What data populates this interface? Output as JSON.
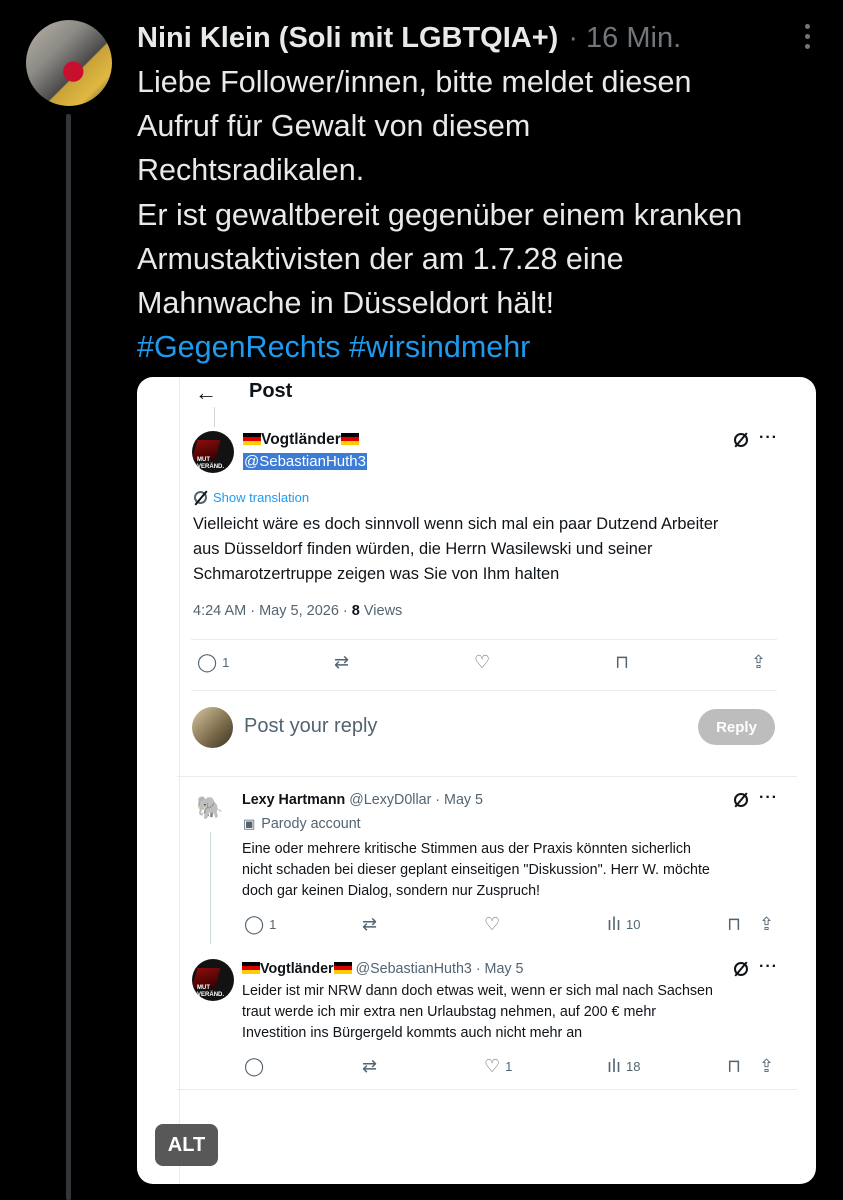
{
  "post": {
    "author_name": "Nini Klein (Soli mit LGBTQIA+)",
    "time": "· 16 Min.",
    "body_lines": [
      "Liebe Follower/innen, bitte meldet diesen",
      "Aufruf für Gewalt von diesem",
      "Rechtsradikalen.",
      "Er ist gewaltbereit gegenüber einem kranken",
      "Armustaktivisten der am 1.7.28 eine",
      "Mahnwache in Düsseldort hält!"
    ],
    "hashtags": [
      "#GegenRechts",
      "#wirsindmehr"
    ],
    "alt_label": "ALT"
  },
  "screenshot": {
    "header_title": "Post",
    "main_tweet": {
      "user_name": "Vogtländer",
      "handle": "@SebastianHuth3",
      "show_translation": "Show translation",
      "text_lines": [
        "Vielleicht wäre es doch sinnvoll wenn sich mal ein paar Dutzend Arbeiter",
        "aus Düsseldorf finden würden, die Herrn Wasilewski und seiner",
        "Schmarotzertruppe zeigen was Sie von Ihm halten"
      ],
      "timestamp": "4:24 AM · May 5, 2026 · ",
      "views_count": "8",
      "views_label": " Views",
      "reply_count": "1"
    },
    "reply_box": {
      "placeholder": "Post your reply",
      "button": "Reply"
    },
    "replies": [
      {
        "user_name": "Lexy Hartmann",
        "meta": "@LexyD0llar · May 5",
        "badge": "Parody account",
        "text_lines": [
          "Eine oder mehrere kritische Stimmen aus der Praxis könnten sicherlich",
          "nicht schaden bei dieser geplant einseitigen \"Diskussion\". Herr W. möchte",
          "doch gar keinen Dialog, sondern nur Zuspruch!"
        ],
        "reply_count": "1",
        "views": "10"
      },
      {
        "user_name": "Vogtländer",
        "meta": "@SebastianHuth3 · May 5",
        "text_lines": [
          "Leider ist mir NRW dann doch etwas weit, wenn er sich mal nach Sachsen",
          "traut werde ich mir extra nen Urlaubstag nehmen, auf 200 € mehr",
          "Investition ins Bürgergeld kommts auch nicht mehr an"
        ],
        "like_count": "1",
        "views": "18"
      }
    ]
  },
  "colors": {
    "link": "#1d9bf0",
    "background": "#000000",
    "muted": "#71767b"
  },
  "icons": [
    "more-vertical-icon",
    "back-arrow-icon",
    "grok-icon",
    "more-horizontal-icon",
    "reply-icon",
    "repost-icon",
    "like-icon",
    "bookmark-icon",
    "share-icon",
    "views-icon",
    "parody-badge-icon"
  ]
}
